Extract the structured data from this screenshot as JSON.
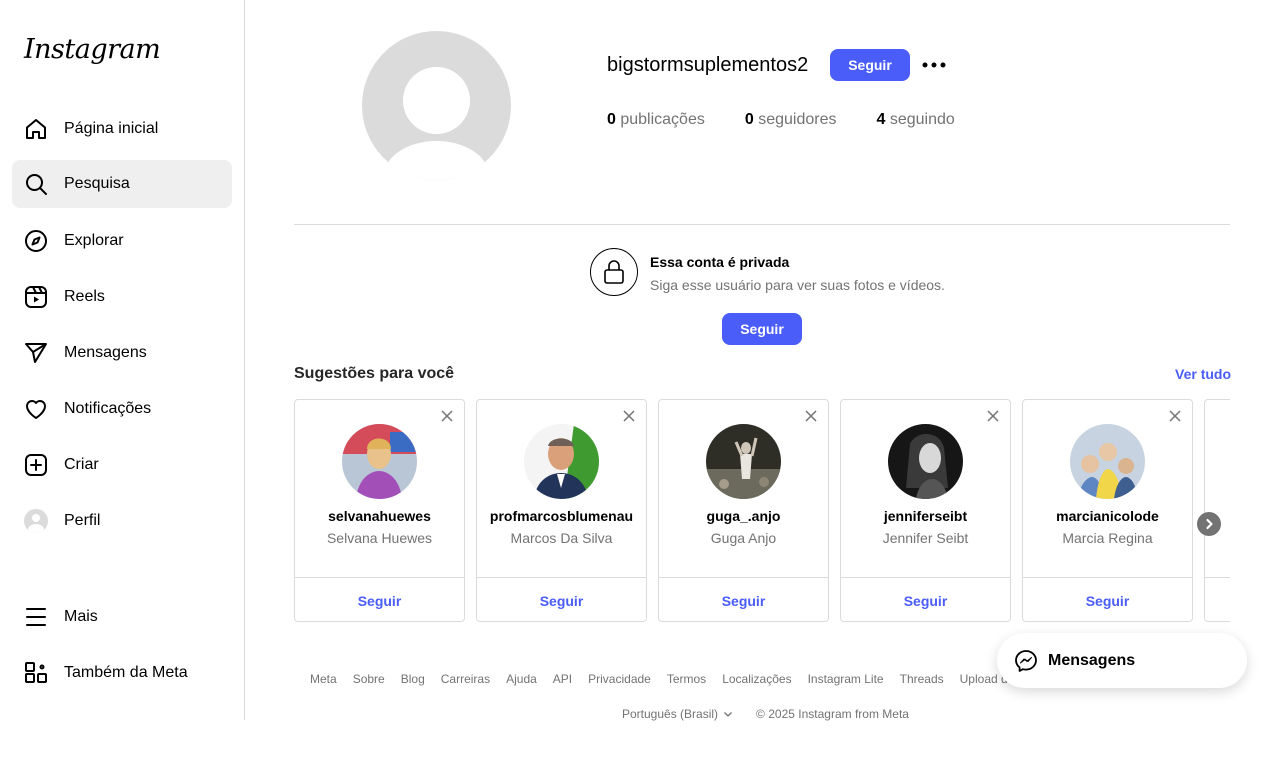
{
  "sidebar": {
    "logo": "Instagram",
    "items": [
      {
        "label": "Página inicial",
        "icon": "home-icon"
      },
      {
        "label": "Pesquisa",
        "icon": "search-icon"
      },
      {
        "label": "Explorar",
        "icon": "compass-icon"
      },
      {
        "label": "Reels",
        "icon": "reels-icon"
      },
      {
        "label": "Mensagens",
        "icon": "send-icon"
      },
      {
        "label": "Notificações",
        "icon": "heart-icon"
      },
      {
        "label": "Criar",
        "icon": "plus-square-icon"
      },
      {
        "label": "Perfil",
        "icon": "avatar"
      }
    ],
    "bottom": [
      {
        "label": "Mais",
        "icon": "menu-icon"
      },
      {
        "label": "Também da Meta",
        "icon": "grid-icon"
      }
    ]
  },
  "profile": {
    "username": "bigstormsuplementos2",
    "follow_label": "Seguir",
    "stats": {
      "posts_count": "0",
      "posts_label": " publicações",
      "followers_count": "0",
      "followers_label": " seguidores",
      "following_count": "4",
      "following_label": " seguindo"
    }
  },
  "private": {
    "title": "Essa conta é privada",
    "subtitle": "Siga esse usuário para ver suas fotos e vídeos.",
    "follow_label": "Seguir"
  },
  "suggestions": {
    "title": "Sugestões para você",
    "see_all": "Ver tudo",
    "cards": [
      {
        "username": "selvanahuewes",
        "name": "Selvana Huewes",
        "follow": "Seguir",
        "avatar_color": "#9b5fb5"
      },
      {
        "username": "profmarcosblumenau",
        "name": "Marcos Da Silva",
        "follow": "Seguir",
        "avatar_color": "#4e8f3a"
      },
      {
        "username": "guga_.anjo",
        "name": "Guga Anjo",
        "follow": "Seguir",
        "avatar_color": "#3b3b33"
      },
      {
        "username": "jenniferseibt",
        "name": "Jennifer Seibt",
        "follow": "Seguir",
        "avatar_color": "#1a1a1a"
      },
      {
        "username": "marcianicolode",
        "name": "Marcia Regina",
        "follow": "Seguir",
        "avatar_color": "#8fa8c8"
      }
    ]
  },
  "footer": {
    "links": [
      "Meta",
      "Sobre",
      "Blog",
      "Carreiras",
      "Ajuda",
      "API",
      "Privacidade",
      "Termos",
      "Localizações",
      "Instagram Lite",
      "Threads",
      "Upload de contatos e não usuários"
    ],
    "language": "Português (Brasil)",
    "copyright": "© 2025 Instagram from Meta"
  },
  "messages_pill": {
    "label": "Mensagens",
    "icon": "messenger-icon"
  },
  "colors": {
    "accent": "#4a5df9",
    "secondary_text": "#737373",
    "border": "#dbdbdb"
  }
}
